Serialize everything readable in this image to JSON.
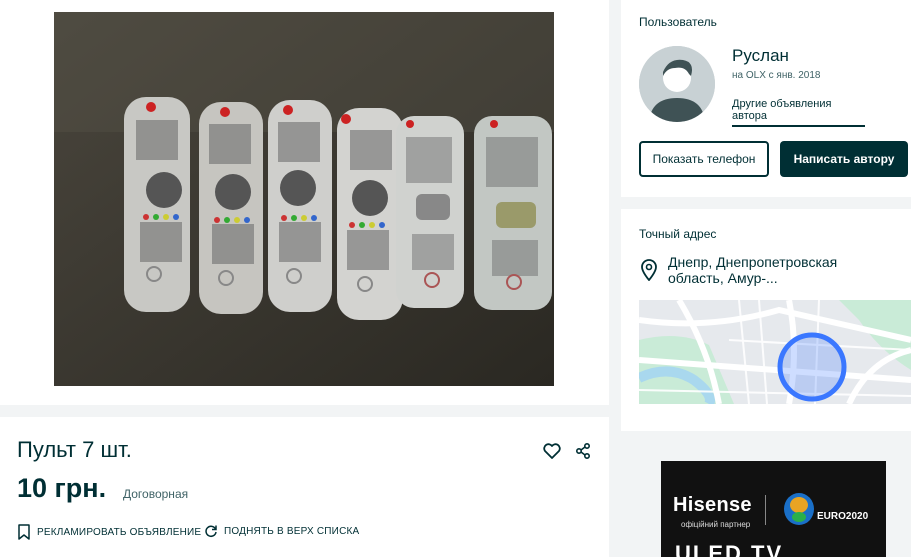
{
  "ad": {
    "title": "Пульт 7 шт.",
    "price": "10 грн.",
    "negotiable": "Договорная",
    "actions": {
      "promote": "РЕКЛАМИРОВАТЬ ОБЪЯВЛЕНИЕ",
      "raise": "ПОДНЯТЬ В ВЕРХ СПИСКА"
    },
    "icons": {
      "favorite": "heart-icon",
      "share": "share-icon"
    }
  },
  "user": {
    "heading": "Пользователь",
    "name": "Руслан",
    "since": "на OLX с янв. 2018",
    "other_ads": "Другие объявления автора",
    "show_phone": "Показать телефон",
    "message": "Написать автору"
  },
  "location": {
    "heading": "Точный адрес",
    "address": "Днепр, Днепропетровская область, Амур-..."
  },
  "banner": {
    "brand": "Hisense",
    "partner": "офіційний партнер",
    "event": "EURO2020",
    "product": "ULED TV"
  },
  "colors": {
    "primary": "#002f34",
    "background": "#f2f4f5",
    "map_marker": "#3a77ff"
  }
}
